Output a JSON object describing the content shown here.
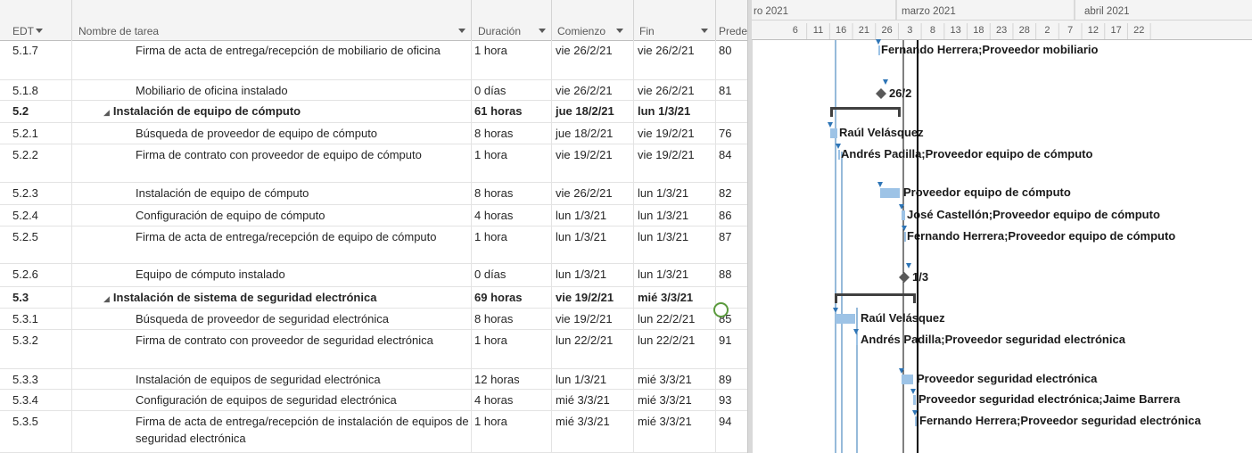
{
  "columns": {
    "edt": "EDT",
    "nombre": "Nombre de tarea",
    "duracion": "Duración",
    "comienzo": "Comienzo",
    "fin": "Fin",
    "pred": "Predecesoras"
  },
  "timescale": {
    "months": [
      "ro 2021",
      "marzo 2021",
      "abril 2021"
    ],
    "days": [
      "6",
      "11",
      "16",
      "21",
      "26",
      "3",
      "8",
      "13",
      "18",
      "23",
      "28",
      "2",
      "7",
      "12",
      "17",
      "22"
    ]
  },
  "tasks": [
    {
      "edt": "5.1.7",
      "name": "Firma de acta de entrega/recepción de mobiliario de oficina",
      "dur": "1 hora",
      "start": "vie 26/2/21",
      "end": "vie 26/2/21",
      "pred": "80",
      "summary": false,
      "label": "Fernando Herrera;Proveedor mobiliario"
    },
    {
      "edt": "5.1.8",
      "name": "Mobiliario de oficina instalado",
      "dur": "0 días",
      "start": "vie 26/2/21",
      "end": "vie 26/2/21",
      "pred": "81",
      "summary": false,
      "label": "26/2"
    },
    {
      "edt": "5.2",
      "name": "Instalación de equipo de cómputo",
      "dur": "61 horas",
      "start": "jue 18/2/21",
      "end": "lun 1/3/21",
      "pred": "",
      "summary": true,
      "label": ""
    },
    {
      "edt": "5.2.1",
      "name": "Búsqueda de proveedor de equipo de cómputo",
      "dur": "8 horas",
      "start": "jue 18/2/21",
      "end": "vie 19/2/21",
      "pred": "76",
      "summary": false,
      "label": "Raúl Velásquez"
    },
    {
      "edt": "5.2.2",
      "name": "Firma de contrato con proveedor de equipo de cómputo",
      "dur": "1 hora",
      "start": "vie 19/2/21",
      "end": "vie 19/2/21",
      "pred": "84",
      "summary": false,
      "label": "Andrés Padilla;Proveedor equipo de cómputo"
    },
    {
      "edt": "5.2.3",
      "name": "Instalación de equipo de cómputo",
      "dur": "8 horas",
      "start": "vie 26/2/21",
      "end": "lun 1/3/21",
      "pred": "82",
      "summary": false,
      "label": "Proveedor equipo de cómputo"
    },
    {
      "edt": "5.2.4",
      "name": "Configuración de equipo de cómputo",
      "dur": "4 horas",
      "start": "lun 1/3/21",
      "end": "lun 1/3/21",
      "pred": "86",
      "summary": false,
      "label": "José Castellón;Proveedor equipo de cómputo"
    },
    {
      "edt": "5.2.5",
      "name": "Firma de acta de entrega/recepción de equipo de cómputo",
      "dur": "1 hora",
      "start": "lun 1/3/21",
      "end": "lun 1/3/21",
      "pred": "87",
      "summary": false,
      "label": "Fernando Herrera;Proveedor equipo de cómputo"
    },
    {
      "edt": "5.2.6",
      "name": "Equipo de cómputo instalado",
      "dur": "0 días",
      "start": "lun 1/3/21",
      "end": "lun 1/3/21",
      "pred": "88",
      "summary": false,
      "label": "1/3"
    },
    {
      "edt": "5.3",
      "name": "Instalación de sistema de seguridad electrónica",
      "dur": "69 horas",
      "start": "vie 19/2/21",
      "end": "mié 3/3/21",
      "pred": "",
      "summary": true,
      "label": ""
    },
    {
      "edt": "5.3.1",
      "name": "Búsqueda de proveedor de seguridad electrónica",
      "dur": "8 horas",
      "start": "vie 19/2/21",
      "end": "lun 22/2/21",
      "pred": "85",
      "summary": false,
      "label": "Raúl Velásquez"
    },
    {
      "edt": "5.3.2",
      "name": "Firma de contrato con proveedor de seguridad electrónica",
      "dur": "1 hora",
      "start": "lun 22/2/21",
      "end": "lun 22/2/21",
      "pred": "91",
      "summary": false,
      "label": "Andrés Padilla;Proveedor seguridad electrónica"
    },
    {
      "edt": "5.3.3",
      "name": "Instalación de equipos de seguridad electrónica",
      "dur": "12 horas",
      "start": "lun 1/3/21",
      "end": "mié 3/3/21",
      "pred": "89",
      "summary": false,
      "label": "Proveedor seguridad electrónica"
    },
    {
      "edt": "5.3.4",
      "name": "Configuración de equipos de seguridad electrónica",
      "dur": "4 horas",
      "start": "mié 3/3/21",
      "end": "mié 3/3/21",
      "pred": "93",
      "summary": false,
      "label": "Proveedor seguridad electrónica;Jaime Barrera"
    },
    {
      "edt": "5.3.5",
      "name": "Firma de acta de entrega/recepción de instalación de equipos de seguridad electrónica",
      "dur": "1 hora",
      "start": "mié 3/3/21",
      "end": "mié 3/3/21",
      "pred": "94",
      "summary": false,
      "label": "Fernando Herrera;Proveedor seguridad electrónica"
    }
  ],
  "colors": {
    "bar": "#9dc3e6",
    "summary": "#404040",
    "milestone": "#595959",
    "link": "#2e75b6",
    "today_line": "#000000"
  }
}
